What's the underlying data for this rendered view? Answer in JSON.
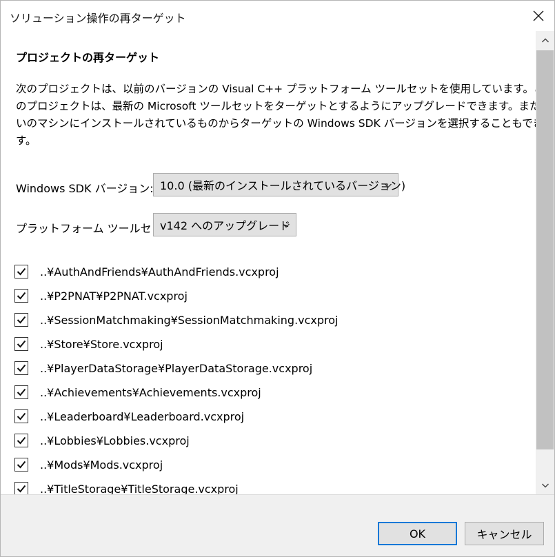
{
  "window": {
    "title": "ソリューション操作の再ターゲット"
  },
  "section_title": "プロジェクトの再ターゲット",
  "description_lines": [
    "次のプロジェクトは、以前のバージョンの Visual C++ プラットフォーム ツールセットを使用しています。これら",
    "のプロジェクトは、最新の Microsoft ツールセットをターゲットとするようにアップグレードできます。また、お使",
    "いのマシンにインストールされているものからターゲットの Windows SDK バージョンを選択することもできま",
    "す。"
  ],
  "sdk": {
    "label": "Windows SDK バージョン:",
    "value": "10.0 (最新のインストールされているバージョン)"
  },
  "toolset": {
    "label": "プラットフォーム ツールセット:",
    "value": "v142 へのアップグレード"
  },
  "projects": [
    {
      "label": "..¥AuthAndFriends¥AuthAndFriends.vcxproj",
      "checked": true
    },
    {
      "label": "..¥P2PNAT¥P2PNAT.vcxproj",
      "checked": true
    },
    {
      "label": "..¥SessionMatchmaking¥SessionMatchmaking.vcxproj",
      "checked": true
    },
    {
      "label": "..¥Store¥Store.vcxproj",
      "checked": true
    },
    {
      "label": "..¥PlayerDataStorage¥PlayerDataStorage.vcxproj",
      "checked": true
    },
    {
      "label": "..¥Achievements¥Achievements.vcxproj",
      "checked": true
    },
    {
      "label": "..¥Leaderboard¥Leaderboard.vcxproj",
      "checked": true
    },
    {
      "label": "..¥Lobbies¥Lobbies.vcxproj",
      "checked": true
    },
    {
      "label": "..¥Mods¥Mods.vcxproj",
      "checked": true
    },
    {
      "label": "..¥TitleStorage¥TitleStorage.vcxproj",
      "checked": true
    }
  ],
  "buttons": {
    "ok": "OK",
    "cancel": "キャンセル"
  },
  "colors": {
    "accent": "#0078d7",
    "button_bg": "#e1e1e1",
    "footer_bg": "#f0f0f0",
    "scroll_thumb": "#c1c1c1"
  }
}
